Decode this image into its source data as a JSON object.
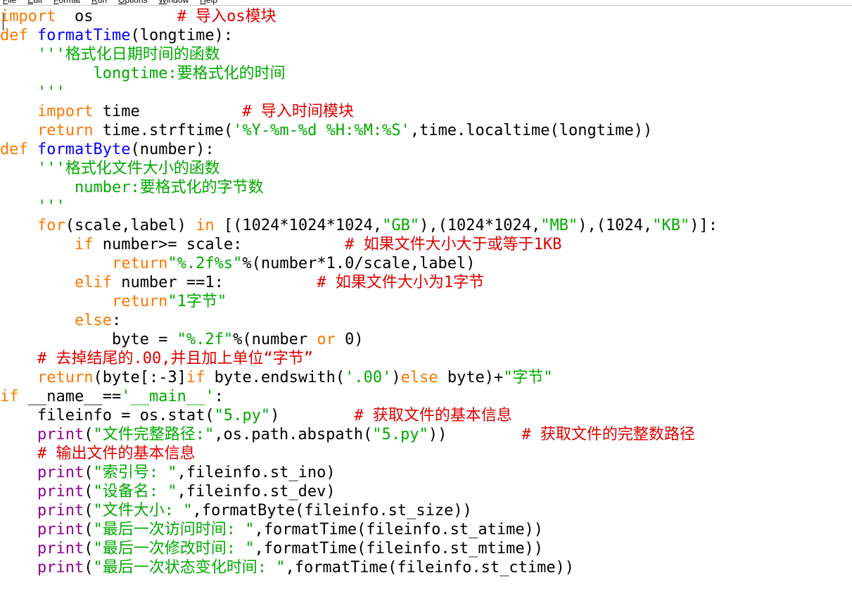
{
  "menu": {
    "items": [
      {
        "mnemonic": "F",
        "rest": "ile"
      },
      {
        "mnemonic": "E",
        "rest": "dit"
      },
      {
        "mnemonic": "F",
        "rest": "ormat"
      },
      {
        "mnemonic": "R",
        "rest": "un"
      },
      {
        "mnemonic": "O",
        "rest": "ptions"
      },
      {
        "mnemonic": "W",
        "rest": "indow"
      },
      {
        "mnemonic": "H",
        "rest": "elp"
      }
    ]
  },
  "colors": {
    "keyword": "#ff7700",
    "definition": "#0000ff",
    "string": "#00aa00",
    "comment": "#dd0000",
    "builtin": "#900090",
    "text": "#000000",
    "background": "#ffffff"
  },
  "code": {
    "lines": [
      [
        [
          "kw",
          "import"
        ],
        [
          "",
          "  os"
        ],
        [
          "",
          "         "
        ],
        [
          "cmt",
          "# 导入os模块"
        ]
      ],
      [
        [
          "kw",
          "def"
        ],
        [
          "",
          " "
        ],
        [
          "def",
          "formatTime"
        ],
        [
          "",
          "(longtime):"
        ]
      ],
      [
        [
          "",
          "    "
        ],
        [
          "str",
          "'''格式化日期时间的函数"
        ]
      ],
      [
        [
          "str",
          "          longtime:要格式化的时间"
        ]
      ],
      [
        [
          "str",
          "    '''"
        ]
      ],
      [
        [
          "",
          "    "
        ],
        [
          "kw",
          "import"
        ],
        [
          "",
          " time"
        ],
        [
          "",
          "           "
        ],
        [
          "cmt",
          "# 导入时间模块"
        ]
      ],
      [
        [
          "",
          "    "
        ],
        [
          "kw",
          "return"
        ],
        [
          "",
          " time.strftime("
        ],
        [
          "str",
          "'%Y-%m-%d %H:%M:%S'"
        ],
        [
          "",
          ",time.localtime(longtime))"
        ]
      ],
      [
        [
          "kw",
          "def"
        ],
        [
          "",
          " "
        ],
        [
          "def",
          "formatByte"
        ],
        [
          "",
          "(number):"
        ]
      ],
      [
        [
          "",
          "    "
        ],
        [
          "str",
          "'''格式化文件大小的函数"
        ]
      ],
      [
        [
          "str",
          "        number:要格式化的字节数"
        ]
      ],
      [
        [
          "str",
          "    '''"
        ]
      ],
      [
        [
          "",
          "    "
        ],
        [
          "kw",
          "for"
        ],
        [
          "",
          "(scale,label) "
        ],
        [
          "kw",
          "in"
        ],
        [
          "",
          " [(1024*1024*1024,"
        ],
        [
          "str",
          "\"GB\""
        ],
        [
          "",
          "),(1024*1024,"
        ],
        [
          "str",
          "\"MB\""
        ],
        [
          "",
          "),(1024,"
        ],
        [
          "str",
          "\"KB\""
        ],
        [
          "",
          ")]:"
        ]
      ],
      [
        [
          "",
          "        "
        ],
        [
          "kw",
          "if"
        ],
        [
          "",
          " number>= scale:"
        ],
        [
          "",
          "           "
        ],
        [
          "cmt",
          "# 如果文件大小大于或等于1KB"
        ]
      ],
      [
        [
          "",
          "            "
        ],
        [
          "kw",
          "return"
        ],
        [
          "str",
          "\"%.2f%s\""
        ],
        [
          "",
          "%(number*1.0/scale,label)"
        ]
      ],
      [
        [
          "",
          "        "
        ],
        [
          "kw",
          "elif"
        ],
        [
          "",
          " number ==1:"
        ],
        [
          "",
          "          "
        ],
        [
          "cmt",
          "# 如果文件大小为1字节"
        ]
      ],
      [
        [
          "",
          "            "
        ],
        [
          "kw",
          "return"
        ],
        [
          "str",
          "\"1字节\""
        ]
      ],
      [
        [
          "",
          "        "
        ],
        [
          "kw",
          "else"
        ],
        [
          "",
          ":"
        ]
      ],
      [
        [
          "",
          "            byte = "
        ],
        [
          "str",
          "\"%.2f\""
        ],
        [
          "",
          "%(number "
        ],
        [
          "kw",
          "or"
        ],
        [
          "",
          " 0)"
        ]
      ],
      [
        [
          "",
          "    "
        ],
        [
          "cmt",
          "# 去掉结尾的.00,并且加上单位“字节”"
        ]
      ],
      [
        [
          "",
          "    "
        ],
        [
          "kw",
          "return"
        ],
        [
          "",
          "(byte[:-3]"
        ],
        [
          "kw",
          "if"
        ],
        [
          "",
          " byte.endswith("
        ],
        [
          "str",
          "'.00'"
        ],
        [
          "",
          ")"
        ],
        [
          "kw",
          "else"
        ],
        [
          "",
          " byte)+"
        ],
        [
          "str",
          "\"字节\""
        ]
      ],
      [
        [
          "kw",
          "if"
        ],
        [
          "",
          " __name__=="
        ],
        [
          "str",
          "'__main__'"
        ],
        [
          "",
          ":"
        ]
      ],
      [
        [
          "",
          "    fileinfo = os.stat("
        ],
        [
          "str",
          "\"5.py\""
        ],
        [
          "",
          ")"
        ],
        [
          "",
          "        "
        ],
        [
          "cmt",
          "# 获取文件的基本信息"
        ]
      ],
      [
        [
          "",
          "    "
        ],
        [
          "bi",
          "print"
        ],
        [
          "",
          "("
        ],
        [
          "str",
          "\"文件完整路径:\""
        ],
        [
          "",
          ",os.path.abspath("
        ],
        [
          "str",
          "\"5.py\""
        ],
        [
          "",
          "))"
        ],
        [
          "",
          "        "
        ],
        [
          "cmt",
          "# 获取文件的完整数路径"
        ]
      ],
      [
        [
          "",
          "    "
        ],
        [
          "cmt",
          "# 输出文件的基本信息"
        ]
      ],
      [
        [
          "",
          "    "
        ],
        [
          "bi",
          "print"
        ],
        [
          "",
          "("
        ],
        [
          "str",
          "\"索引号: \""
        ],
        [
          "",
          ",fileinfo.st_ino)"
        ]
      ],
      [
        [
          "",
          "    "
        ],
        [
          "bi",
          "print"
        ],
        [
          "",
          "("
        ],
        [
          "str",
          "\"设备名: \""
        ],
        [
          "",
          ",fileinfo.st_dev)"
        ]
      ],
      [
        [
          "",
          "    "
        ],
        [
          "bi",
          "print"
        ],
        [
          "",
          "("
        ],
        [
          "str",
          "\"文件大小: \""
        ],
        [
          "",
          ",formatByte(fileinfo.st_size))"
        ]
      ],
      [
        [
          "",
          "    "
        ],
        [
          "bi",
          "print"
        ],
        [
          "",
          "("
        ],
        [
          "str",
          "\"最后一次访问时间: \""
        ],
        [
          "",
          ",formatTime(fileinfo.st_atime))"
        ]
      ],
      [
        [
          "",
          "    "
        ],
        [
          "bi",
          "print"
        ],
        [
          "",
          "("
        ],
        [
          "str",
          "\"最后一次修改时间: \""
        ],
        [
          "",
          ",formatTime(fileinfo.st_mtime))"
        ]
      ],
      [
        [
          "",
          "    "
        ],
        [
          "bi",
          "print"
        ],
        [
          "",
          "("
        ],
        [
          "str",
          "\"最后一次状态变化时间: \""
        ],
        [
          "",
          ",formatTime(fileinfo.st_ctime))"
        ]
      ]
    ]
  }
}
